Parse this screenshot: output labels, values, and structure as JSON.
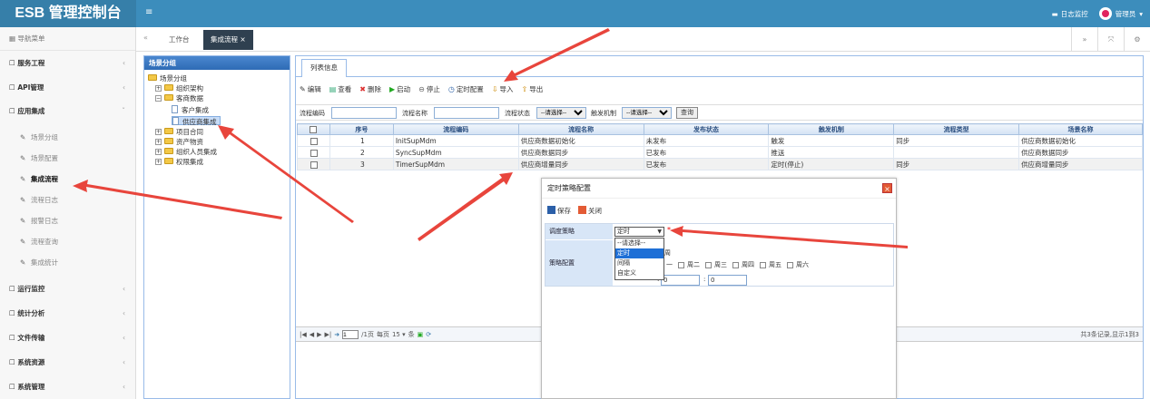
{
  "app": {
    "title": "ESB 管理控制台"
  },
  "topbar": {
    "monitor_label": "日志监控",
    "user_label": "管理员"
  },
  "sidebar": {
    "header": "导航菜单",
    "groups": [
      {
        "label": "服务工程"
      },
      {
        "label": "API管理"
      },
      {
        "label": "应用集成"
      },
      {
        "label": "运行监控"
      },
      {
        "label": "统计分析"
      },
      {
        "label": "文件传输"
      },
      {
        "label": "系统资源"
      },
      {
        "label": "系统管理"
      }
    ],
    "subitems": [
      {
        "label": "场景分组"
      },
      {
        "label": "场景配置"
      },
      {
        "label": "集成流程"
      },
      {
        "label": "流程日志"
      },
      {
        "label": "报警日志"
      },
      {
        "label": "流程查询"
      },
      {
        "label": "集成统计"
      }
    ]
  },
  "tabs": {
    "home": "工作台",
    "current": "集成流程"
  },
  "tree": {
    "title": "场景分组",
    "root": "场景分组",
    "nodes": [
      "组织架构",
      "客商数据",
      "客户集成",
      "供应商集成",
      "项目合同",
      "资产物资",
      "组织人员集成",
      "权限集成"
    ]
  },
  "main": {
    "tab": "列表信息",
    "toolbar": {
      "edit": "编辑",
      "view": "查看",
      "delete": "删除",
      "start": "启动",
      "stop": "停止",
      "timer": "定时配置",
      "import": "导入",
      "export": "导出"
    },
    "search": {
      "code_label": "流程编码",
      "name_label": "流程名称",
      "status_label": "流程状态",
      "trigger_label": "触发机制",
      "select_placeholder": "--请选择--",
      "query": "查询"
    },
    "columns": [
      "序号",
      "流程编码",
      "流程名称",
      "发布状态",
      "触发机制",
      "流程类型",
      "场景名称"
    ],
    "rows": [
      {
        "no": "1",
        "code": "InitSupMdm",
        "name": "供应商数据初始化",
        "status": "未发布",
        "trigger": "触发",
        "type": "同步",
        "scene": "供应商数据初始化"
      },
      {
        "no": "2",
        "code": "SyncSupMdm",
        "name": "供应商数据同步",
        "status": "已发布",
        "trigger": "推送",
        "type": "",
        "scene": "供应商数据同步"
      },
      {
        "no": "3",
        "code": "TimerSupMdm",
        "name": "供应商增量同步",
        "status": "已发布",
        "trigger": "定时(停止)",
        "type": "同步",
        "scene": "供应商增量同步"
      }
    ],
    "pager": {
      "page": "1",
      "of_pages": "/1页",
      "per_page_label": "每页",
      "per_page": "15",
      "unit": "条",
      "summary": "共3条记录,显示1到3"
    }
  },
  "dialog": {
    "title": "定时策略配置",
    "save": "保存",
    "close": "关闭",
    "schedule_label": "调度策略",
    "strategy_label": "策略配置",
    "schedule_value": "定时",
    "options": [
      "--请选择--",
      "定时",
      "间隔",
      "自定义"
    ],
    "week_hint": "每周",
    "days": [
      "一",
      "周二",
      "周三",
      "周四",
      "周五",
      "周六"
    ],
    "minute_value": "0",
    "second_value": "0"
  },
  "colors": {
    "topbar": "#3c8dbc",
    "brand": "#367fa9",
    "arrow": "#e8453c",
    "selected_tab": "#2f4050"
  }
}
